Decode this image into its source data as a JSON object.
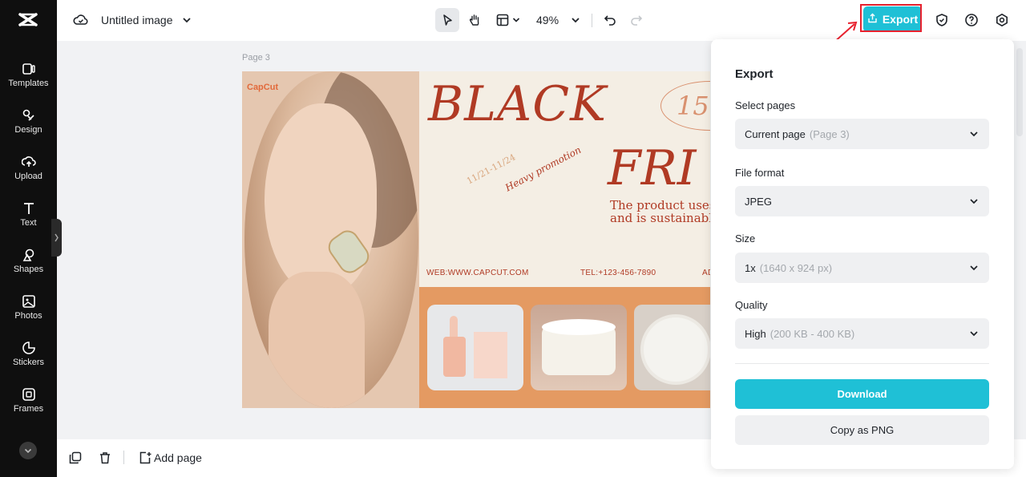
{
  "sidebar": {
    "items": [
      {
        "label": "Templates",
        "icon": "templates-icon"
      },
      {
        "label": "Design",
        "icon": "design-icon"
      },
      {
        "label": "Upload",
        "icon": "upload-icon"
      },
      {
        "label": "Text",
        "icon": "text-icon"
      },
      {
        "label": "Shapes",
        "icon": "shapes-icon"
      },
      {
        "label": "Photos",
        "icon": "photos-icon"
      },
      {
        "label": "Stickers",
        "icon": "stickers-icon"
      },
      {
        "label": "Frames",
        "icon": "frames-icon"
      }
    ]
  },
  "header": {
    "doc_title": "Untitled image",
    "zoom": "49%",
    "export_label": "Export"
  },
  "bottom": {
    "add_page_label": "Add page"
  },
  "canvas": {
    "page_label": "Page 3",
    "brand": "CapCut",
    "headline_1": "BLACK",
    "headline_2": "FRI",
    "badge": "15",
    "dates": "11/21-11/24",
    "promo": "Heavy promotion",
    "desc_line_1": "The product uses",
    "desc_line_2": "and is sustainable.",
    "web": "WEB:WWW.CAPCUT.COM",
    "tel": "TEL:+123-456-7890",
    "addr": "AD"
  },
  "export_panel": {
    "title": "Export",
    "select_pages_label": "Select pages",
    "select_pages_value": "Current page",
    "select_pages_hint": "(Page 3)",
    "file_format_label": "File format",
    "file_format_value": "JPEG",
    "size_label": "Size",
    "size_value": "1x",
    "size_hint": "(1640 x 924 px)",
    "quality_label": "Quality",
    "quality_value": "High",
    "quality_hint": "(200 KB - 400 KB)",
    "download_label": "Download",
    "copy_label": "Copy as PNG"
  },
  "colors": {
    "accent": "#1fc0d6",
    "highlight": "#e8212e",
    "sidebar_bg": "#0f0f0f"
  }
}
